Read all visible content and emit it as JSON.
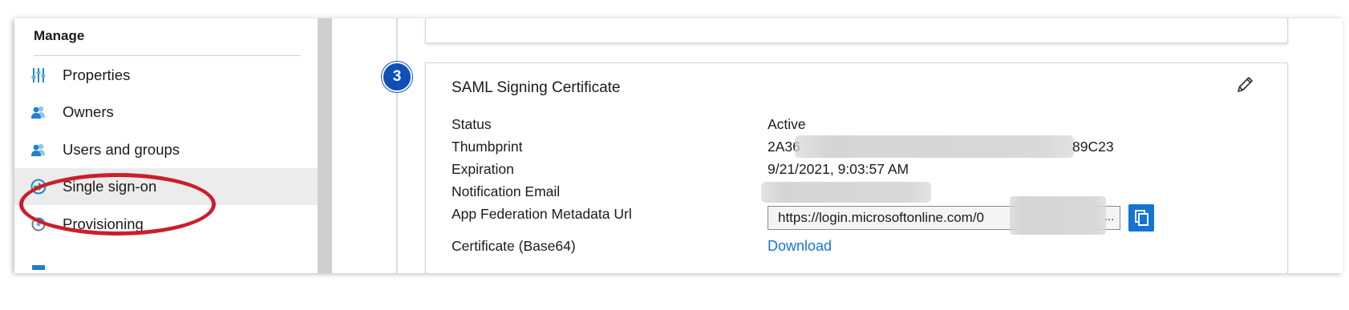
{
  "nav": {
    "heading": "Manage",
    "items": [
      {
        "label": "Properties",
        "icon": "properties-icon",
        "selected": false
      },
      {
        "label": "Owners",
        "icon": "owners-icon",
        "selected": false
      },
      {
        "label": "Users and groups",
        "icon": "users-groups-icon",
        "selected": false
      },
      {
        "label": "Single sign-on",
        "icon": "single-sign-on-icon",
        "selected": true
      },
      {
        "label": "Provisioning",
        "icon": "provisioning-icon",
        "selected": false
      }
    ]
  },
  "step": {
    "number": "3"
  },
  "certificate": {
    "title": "SAML Signing Certificate",
    "edit_icon": "pencil-icon",
    "status_label": "Status",
    "status_value": "Active",
    "thumbprint_label": "Thumbprint",
    "thumbprint_prefix": "2A36",
    "thumbprint_suffix": "89C23",
    "expiration_label": "Expiration",
    "expiration_value": "9/21/2021, 9:03:57 AM",
    "notification_label": "Notification Email",
    "metadata_url_label": "App Federation Metadata Url",
    "metadata_url_value": "https://login.microsoftonline.com/0",
    "metadata_url_more": "...",
    "copy_icon": "copy-icon",
    "cert_base64_label": "Certificate (Base64)",
    "download_label": "Download"
  },
  "colors": {
    "accent": "#1573d4",
    "step_badge": "#0f4fb8",
    "highlight": "#cc1d2b",
    "selected_bg": "#ececec"
  }
}
